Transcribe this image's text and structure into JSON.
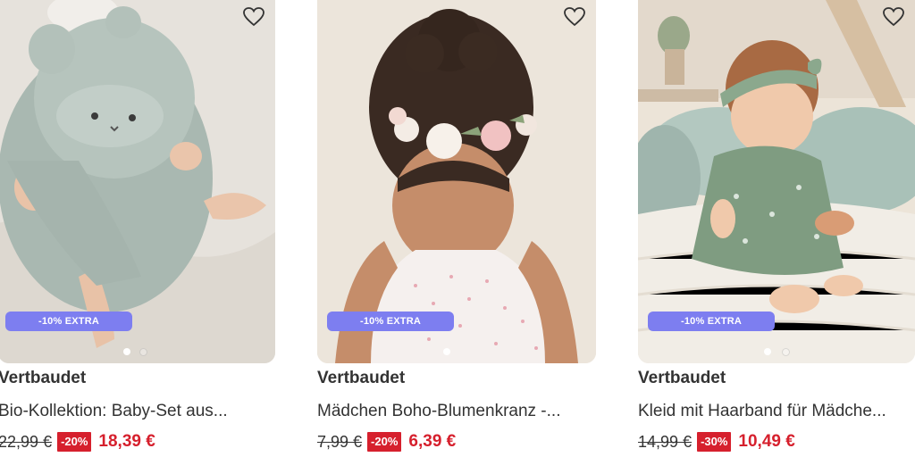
{
  "products": [
    {
      "brand": "Vertbaudet",
      "title": "Bio-Kollektion: Baby-Set aus...",
      "old_price": "22,99 €",
      "discount": "-20%",
      "price": "18,39 €",
      "promo": "-10% EXTRA",
      "image_icon": "baby-hooded-towel-photo",
      "dots": 2,
      "active_dot": 0
    },
    {
      "brand": "Vertbaudet",
      "title": "Mädchen Boho-Blumenkranz -...",
      "old_price": "7,99 €",
      "discount": "-20%",
      "price": "6,39 €",
      "promo": "-10% EXTRA",
      "image_icon": "girl-flower-crown-photo",
      "dots": 1,
      "active_dot": 0
    },
    {
      "brand": "Vertbaudet",
      "title": "Kleid mit Haarband für Mädche...",
      "old_price": "14,99 €",
      "discount": "-30%",
      "price": "10,49 €",
      "promo": "-10% EXTRA",
      "image_icon": "baby-green-dress-photo",
      "dots": 2,
      "active_dot": 0
    }
  ],
  "colors": {
    "promo_badge": "#7d7ef0",
    "sale_red": "#d6202d",
    "text": "#333333"
  }
}
